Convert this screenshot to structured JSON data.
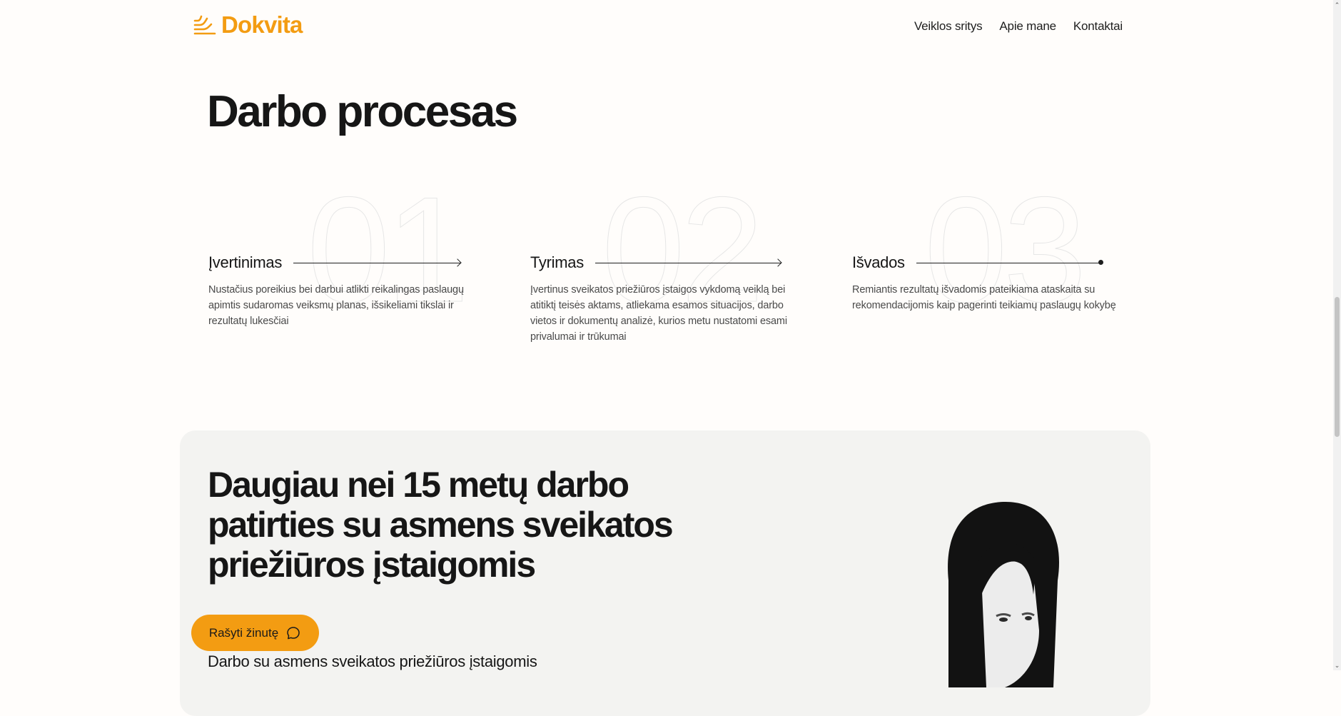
{
  "brand": {
    "name": "Dokvita",
    "accent": "#f39c12",
    "icon": "logo-waves-icon"
  },
  "nav": {
    "items": [
      "Veiklos sritys",
      "Apie mane",
      "Kontaktai"
    ]
  },
  "process": {
    "title": "Darbo procesas",
    "steps": [
      {
        "number": "01",
        "title": "Įvertinimas",
        "desc": "Nustačius poreikius bei darbui atlikti reikalingas paslaugų apimtis sudaromas veiksmų planas, išsikeliami tikslai ir rezultatų lukesčiai"
      },
      {
        "number": "02",
        "title": "Tyrimas",
        "desc": "Įvertinus sveikatos priežiūros įstaigos vykdomą veiklą bei atitiktį teisės aktams, atliekama esamos situacijos, darbo vietos ir dokumentų analizė, kurios metu nustatomi esami privalumai ir trūkumai"
      },
      {
        "number": "03",
        "title": "Išvados",
        "desc": "Remiantis rezultatų išvadomis pateikiama ataskaita su rekomendacijomis kaip pagerinti teikiamų paslaugų kokybę"
      }
    ]
  },
  "experience": {
    "title": "Daugiau nei 15 metų darbo patirties su asmens sveikatos priežiūros įstaigomis",
    "cta_label": "Rašyti žinutę",
    "cta_icon": "chat-bubble-icon",
    "subtitle": "Darbo su asmens sveikatos priežiūros įstaigomis",
    "card_bg": "#f3f3f1"
  },
  "scrollbar": {
    "up": "⌃",
    "down": "⌄"
  }
}
